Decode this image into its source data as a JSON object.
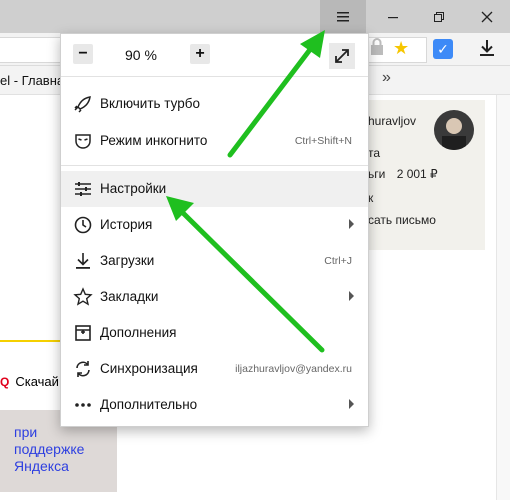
{
  "browser": {
    "bookmark_left": "el - Главна",
    "bookmark_more": "»"
  },
  "page": {
    "profile_name": "huravljov",
    "profile_line1": "та",
    "profile_line2_prefix": "ьги",
    "profile_balance": "2 001 ₽",
    "profile_line3": "к",
    "profile_write": "сать письмо",
    "search_label": "Скачай",
    "promo_lines": [
      "при",
      "поддержке",
      "Яндекса"
    ]
  },
  "menu": {
    "zoom_minus": "−",
    "zoom_value": "90 %",
    "zoom_plus": "+",
    "items": [
      {
        "label": "Включить турбо",
        "shortcut": ""
      },
      {
        "label": "Режим инкогнито",
        "shortcut": "Ctrl+Shift+N"
      },
      {
        "label": "Настройки",
        "shortcut": ""
      },
      {
        "label": "История",
        "shortcut": ""
      },
      {
        "label": "Загрузки",
        "shortcut": "Ctrl+J"
      },
      {
        "label": "Закладки",
        "shortcut": ""
      },
      {
        "label": "Дополнения",
        "shortcut": ""
      },
      {
        "label": "Синхронизация",
        "shortcut": "iljazhuravljov@yandex.ru"
      },
      {
        "label": "Дополнительно",
        "shortcut": ""
      }
    ]
  },
  "colors": {
    "arrow": "#1fbf1f",
    "promo_text": "#2d3fe0",
    "accent_yellow": "#f5d000"
  }
}
